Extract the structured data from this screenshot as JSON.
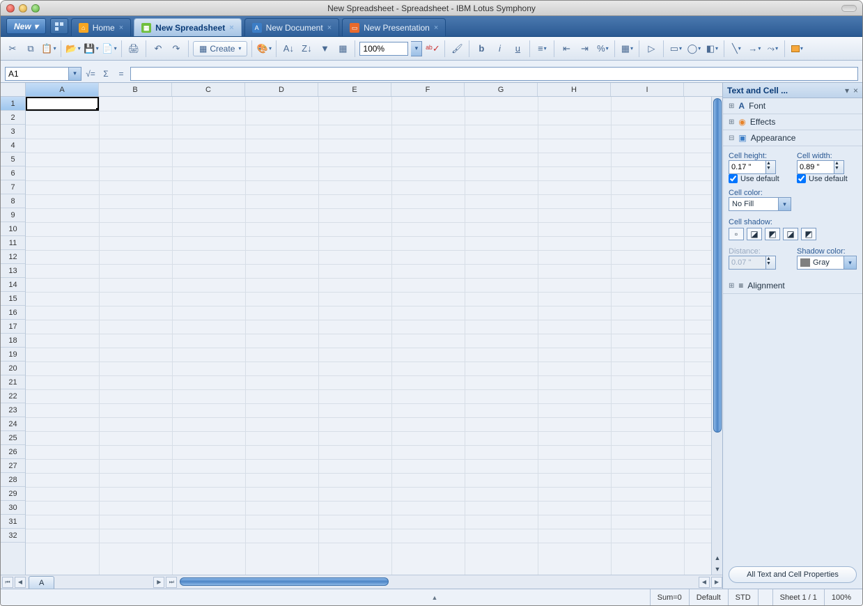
{
  "window": {
    "title": "New Spreadsheet - Spreadsheet - IBM Lotus Symphony"
  },
  "tabbar": {
    "new_label": "New",
    "tabs": [
      {
        "label": "Home"
      },
      {
        "label": "New Spreadsheet"
      },
      {
        "label": "New Document"
      },
      {
        "label": "New Presentation"
      }
    ]
  },
  "toolbar": {
    "create_label": "Create",
    "zoom": "100%"
  },
  "formula": {
    "cellref": "A1"
  },
  "grid": {
    "columns": [
      "A",
      "B",
      "C",
      "D",
      "E",
      "F",
      "G",
      "H",
      "I"
    ],
    "rows": [
      "1",
      "2",
      "3",
      "4",
      "5",
      "6",
      "7",
      "8",
      "9",
      "10",
      "11",
      "12",
      "13",
      "14",
      "15",
      "16",
      "17",
      "18",
      "19",
      "20",
      "21",
      "22",
      "23",
      "24",
      "25",
      "26",
      "27",
      "28",
      "29",
      "30",
      "31",
      "32"
    ]
  },
  "sheettab": {
    "name": "A"
  },
  "sidepanel": {
    "title": "Text and Cell ...",
    "font_label": "Font",
    "effects_label": "Effects",
    "appearance_label": "Appearance",
    "cell_height_label": "Cell height:",
    "cell_height_value": "0.17 \"",
    "cell_width_label": "Cell width:",
    "cell_width_value": "0.89 \"",
    "use_default_label": "Use default",
    "cell_color_label": "Cell color:",
    "cell_color_value": "No Fill",
    "cell_shadow_label": "Cell shadow:",
    "distance_label": "Distance:",
    "distance_value": "0.07 \"",
    "shadow_color_label": "Shadow color:",
    "shadow_color_value": "Gray",
    "alignment_label": "Alignment",
    "all_props_label": "All Text and Cell Properties"
  },
  "status": {
    "sum": "Sum=0",
    "default": "Default",
    "std": "STD",
    "sheet": "Sheet 1 / 1",
    "zoom": "100%"
  }
}
